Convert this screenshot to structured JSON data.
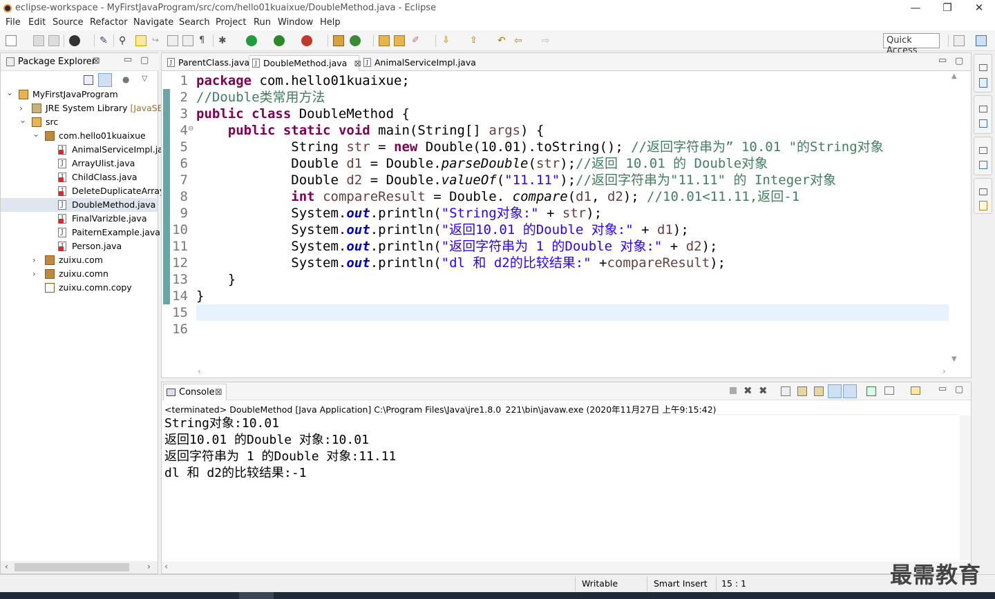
{
  "window": {
    "title": "eclipse-workspace - MyFirstJavaProgram/src/com/hello01kuaixue/DoubleMethod.java - Eclipse",
    "minimize": "—",
    "maximize": "❐",
    "close": "✕"
  },
  "menu": [
    "File",
    "Edit",
    "Source",
    "Refactor",
    "Navigate",
    "Search",
    "Project",
    "Run",
    "Window",
    "Help"
  ],
  "toolbar": {
    "quick_access": "Quick Access"
  },
  "package_explorer": {
    "title": "Package Explorer",
    "close": "⊠",
    "tree": [
      {
        "label": "MyFirstJavaProgram",
        "level": 0,
        "expanded": true,
        "kind": "project"
      },
      {
        "label": "JRE System Library",
        "suffix": "[JavaSE-",
        "level": 1,
        "expanded": false,
        "kind": "library"
      },
      {
        "label": "src",
        "level": 1,
        "expanded": true,
        "kind": "srcfolder"
      },
      {
        "label": "com.hello01kuaixue",
        "level": 2,
        "expanded": true,
        "kind": "package"
      },
      {
        "label": "AnimalServiceImpl.ja",
        "level": 3,
        "kind": "java",
        "error": true
      },
      {
        "label": "ArrayUlist.java",
        "level": 3,
        "kind": "java"
      },
      {
        "label": "ChildClass.java",
        "level": 3,
        "kind": "java",
        "error": true
      },
      {
        "label": "DeleteDuplicateArray",
        "level": 3,
        "kind": "java",
        "error": true
      },
      {
        "label": "DoubleMethod.java",
        "level": 3,
        "kind": "java",
        "selected": true
      },
      {
        "label": "FinalVarizble.java",
        "level": 3,
        "kind": "java",
        "error": true
      },
      {
        "label": "PaiternExample.java",
        "level": 3,
        "kind": "java"
      },
      {
        "label": "Person.java",
        "level": 3,
        "kind": "java",
        "error": true
      },
      {
        "label": "zuixu.com",
        "level": 2,
        "expanded": false,
        "kind": "package"
      },
      {
        "label": "zuixu.comn",
        "level": 2,
        "expanded": false,
        "kind": "package"
      },
      {
        "label": "zuixu.comn.copy",
        "level": 2,
        "kind": "package-empty"
      }
    ]
  },
  "editor": {
    "tabs": [
      {
        "label": "ParentClass.java",
        "active": false
      },
      {
        "label": "DoubleMethod.java",
        "active": true,
        "close": "⊠"
      },
      {
        "label": "AnimalServiceImpl.java",
        "active": false
      }
    ],
    "line_numbers": [
      "1",
      "2",
      "3",
      "4",
      "5",
      "6",
      "7",
      "8",
      "9",
      "10",
      "11",
      "12",
      "13",
      "14",
      "15",
      "16"
    ],
    "code": {
      "l1_kw": "package",
      "l1_rest": " com.hello01kuaixue;",
      "l2_cm": "//Double类常用方法",
      "l3_kw1": "public",
      "l3_kw2": "class",
      "l3_rest": " DoubleMethod {",
      "l4_kw1": "public",
      "l4_kw2": "static",
      "l4_kw3": "void",
      "l4_a": " main(String[] ",
      "l4_var": "args",
      "l4_b": ") {",
      "l5_a": "String ",
      "l5_var": "str",
      "l5_b": " = ",
      "l5_kw": "new",
      "l5_c": " Double(10.01).toString(); ",
      "l5_cm": "//返回字符串为” 10.01 \"的String对象",
      "l6_a": "Double ",
      "l6_var": "d1",
      "l6_b": " = Double.",
      "l6_it": "parseDouble",
      "l6_c": "(",
      "l6_var2": "str",
      "l6_d": ");",
      "l6_cm": "//返回 10.01 的 Double对象",
      "l7_a": "Double ",
      "l7_var": "d2",
      "l7_b": " = Double.",
      "l7_it": "valueOf",
      "l7_c": "(",
      "l7_str": "\"11.11\"",
      "l7_d": ");",
      "l7_cm": "//返回字符串为\"11.11\" 的 Integer对象",
      "l8_kw": "int",
      "l8_sp": " ",
      "l8_var": "compareResult",
      "l8_b": " = Double. ",
      "l8_it": "compare",
      "l8_c": "(",
      "l8_var2": "d1",
      "l8_comma": ", ",
      "l8_var3": "d2",
      "l8_d": "); ",
      "l8_cm": "//10.01<11.11,返回-1",
      "l9_a": "System.",
      "l9_fld": "out",
      "l9_b": ".println(",
      "l9_str": "\"String对象:\"",
      "l9_c": " + ",
      "l9_var": "str",
      "l9_d": ");",
      "l10_a": "System.",
      "l10_fld": "out",
      "l10_b": ".println(",
      "l10_str": "\"返回10.01 的Double 对象:\"",
      "l10_c": " + ",
      "l10_var": "d1",
      "l10_d": ");",
      "l11_a": "System.",
      "l11_fld": "out",
      "l11_b": ".println(",
      "l11_str": "\"返回字符串为 1 的Double 对象:\"",
      "l11_c": " + ",
      "l11_var": "d2",
      "l11_d": ");",
      "l12_a": "System.",
      "l12_fld": "out",
      "l12_b": ".println(",
      "l12_str": "\"dl 和 d2的比较结果:\"",
      "l12_c": " +",
      "l12_var": "compareResult",
      "l12_d": ");",
      "l13": "}",
      "l14": "}"
    }
  },
  "console": {
    "title": "Console",
    "close": "⊠",
    "header": "<terminated> DoubleMethod [Java Application] C:\\Program Files\\Java\\jre1.8.0_221\\bin\\javaw.exe (2020年11月27日 上午9:15:42)",
    "output": [
      "String对象:10.01",
      "返回10.01 的Double 对象:10.01",
      "返回字符串为 1 的Double 对象:11.11",
      "dl 和 d2的比较结果:-1"
    ]
  },
  "status": {
    "mode": "Writable",
    "insert": "Smart Insert",
    "position": "15 : 1"
  },
  "watermark": "最需教育"
}
